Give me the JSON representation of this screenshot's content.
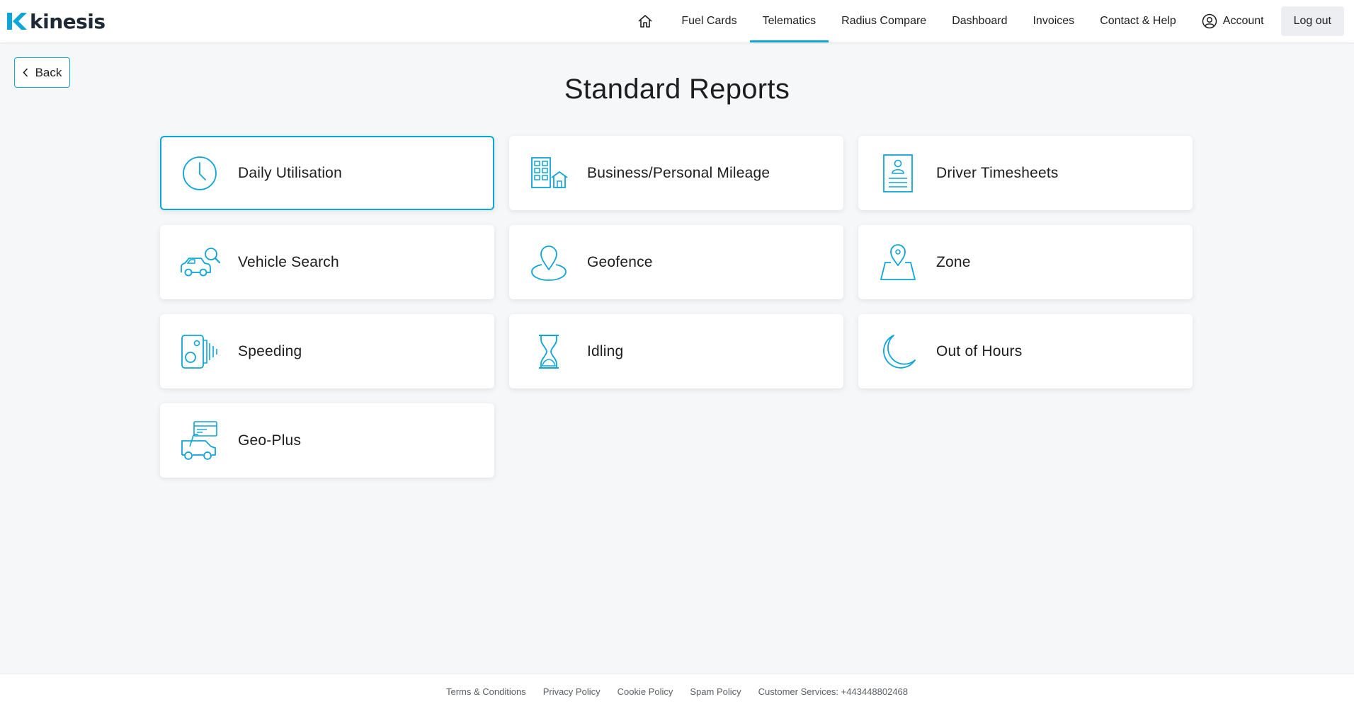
{
  "brand": {
    "name": "kinesis",
    "accent": "#0ea5d8"
  },
  "nav": {
    "home_icon": "home-icon",
    "items": [
      "Fuel Cards",
      "Telematics",
      "Radius Compare",
      "Dashboard",
      "Invoices",
      "Contact & Help"
    ],
    "active": "Telematics",
    "account_label": "Account",
    "logout_label": "Log out"
  },
  "back_label": "Back",
  "page_title": "Standard Reports",
  "reports": [
    {
      "label": "Daily Utilisation",
      "icon": "clock-icon",
      "selected": true
    },
    {
      "label": "Business/Personal Mileage",
      "icon": "buildings-icon"
    },
    {
      "label": "Driver Timesheets",
      "icon": "timesheet-icon"
    },
    {
      "label": "Vehicle Search",
      "icon": "car-search-icon"
    },
    {
      "label": "Geofence",
      "icon": "geofence-pin-icon"
    },
    {
      "label": "Zone",
      "icon": "map-pin-icon"
    },
    {
      "label": "Speeding",
      "icon": "speed-camera-icon"
    },
    {
      "label": "Idling",
      "icon": "hourglass-icon"
    },
    {
      "label": "Out of Hours",
      "icon": "moon-icon"
    },
    {
      "label": "Geo-Plus",
      "icon": "van-card-icon"
    }
  ],
  "footer": {
    "links": [
      "Terms & Conditions",
      "Privacy Policy",
      "Cookie Policy",
      "Spam Policy"
    ],
    "customer_services": "Customer Services: +443448802468"
  }
}
